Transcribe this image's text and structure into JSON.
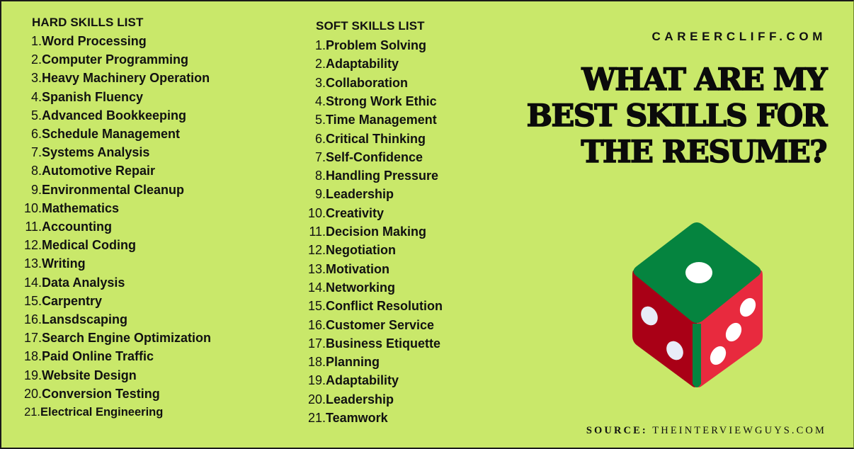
{
  "site": "CAREERCLIFF.COM",
  "headline": [
    "WHAT ARE MY",
    "BEST SKILLS FOR",
    "THE RESUME?"
  ],
  "source": {
    "label": "SOURCE:",
    "value": "THEINTERVIEWGUYS.COM"
  },
  "hard_skills": {
    "title": "HARD SKILLS LIST",
    "items": [
      {
        "n": "1.",
        "text": "Word Processing"
      },
      {
        "n": "2.",
        "text": "Computer Programming"
      },
      {
        "n": "3.",
        "text": "Heavy Machinery Operation"
      },
      {
        "n": "4.",
        "text": "Spanish Fluency"
      },
      {
        "n": "5.",
        "text": "Advanced Bookkeeping"
      },
      {
        "n": "6.",
        "text": "Schedule Management"
      },
      {
        "n": "7.",
        "text": "Systems Analysis"
      },
      {
        "n": "8.",
        "text": "Automotive Repair"
      },
      {
        "n": "9.",
        "text": "Environmental Cleanup"
      },
      {
        "n": "10.",
        "text": "Mathematics"
      },
      {
        "n": "11.",
        "text": "Accounting"
      },
      {
        "n": "12.",
        "text": "Medical Coding"
      },
      {
        "n": "13.",
        "text": "Writing"
      },
      {
        "n": "14.",
        "text": "Data Analysis"
      },
      {
        "n": "15.",
        "text": "Carpentry"
      },
      {
        "n": "16.",
        "text": "Lansdscaping"
      },
      {
        "n": "17.",
        "text": "Search Engine Optimization"
      },
      {
        "n": "18.",
        "text": "Paid Online Traffic"
      },
      {
        "n": "19.",
        "text": "Website Design"
      },
      {
        "n": "20.",
        "text": "Conversion Testing"
      },
      {
        "n": "21.",
        "text": "Electrical Engineering"
      }
    ]
  },
  "soft_skills": {
    "title": "SOFT SKILLS LIST",
    "items": [
      {
        "n": "1.",
        "text": "Problem Solving"
      },
      {
        "n": "2.",
        "text": "Adaptability"
      },
      {
        "n": "3.",
        "text": "Collaboration"
      },
      {
        "n": "4.",
        "text": "Strong Work Ethic"
      },
      {
        "n": "5.",
        "text": "Time Management"
      },
      {
        "n": "6.",
        "text": "Critical Thinking"
      },
      {
        "n": "7.",
        "text": "Self-Confidence"
      },
      {
        "n": "8.",
        "text": "Handling Pressure"
      },
      {
        "n": "9.",
        "text": "Leadership"
      },
      {
        "n": "10.",
        "text": "Creativity"
      },
      {
        "n": "11.",
        "text": "Decision Making"
      },
      {
        "n": "12.",
        "text": "Negotiation"
      },
      {
        "n": "13.",
        "text": "Motivation"
      },
      {
        "n": "14.",
        "text": "Networking"
      },
      {
        "n": "15.",
        "text": "Conflict Resolution"
      },
      {
        "n": "16.",
        "text": "Customer Service"
      },
      {
        "n": "17.",
        "text": "Business Etiquette"
      },
      {
        "n": "18.",
        "text": "Planning"
      },
      {
        "n": "19.",
        "text": "Adaptability"
      },
      {
        "n": "20.",
        "text": "Leadership"
      },
      {
        "n": "21.",
        "text": "Teamwork"
      }
    ]
  },
  "dice": {
    "icon": "dice-icon",
    "colors": {
      "top": "#05843f",
      "left": "#a90016",
      "right": "#e82a3e",
      "edge": "#05843f",
      "pip": "#ffffff",
      "pip_shade": "#e8ecf8"
    },
    "top_pips": 1,
    "left_pips": 2,
    "right_pips": 3
  },
  "colors": {
    "background": "#c9e86a",
    "text": "#111111"
  }
}
